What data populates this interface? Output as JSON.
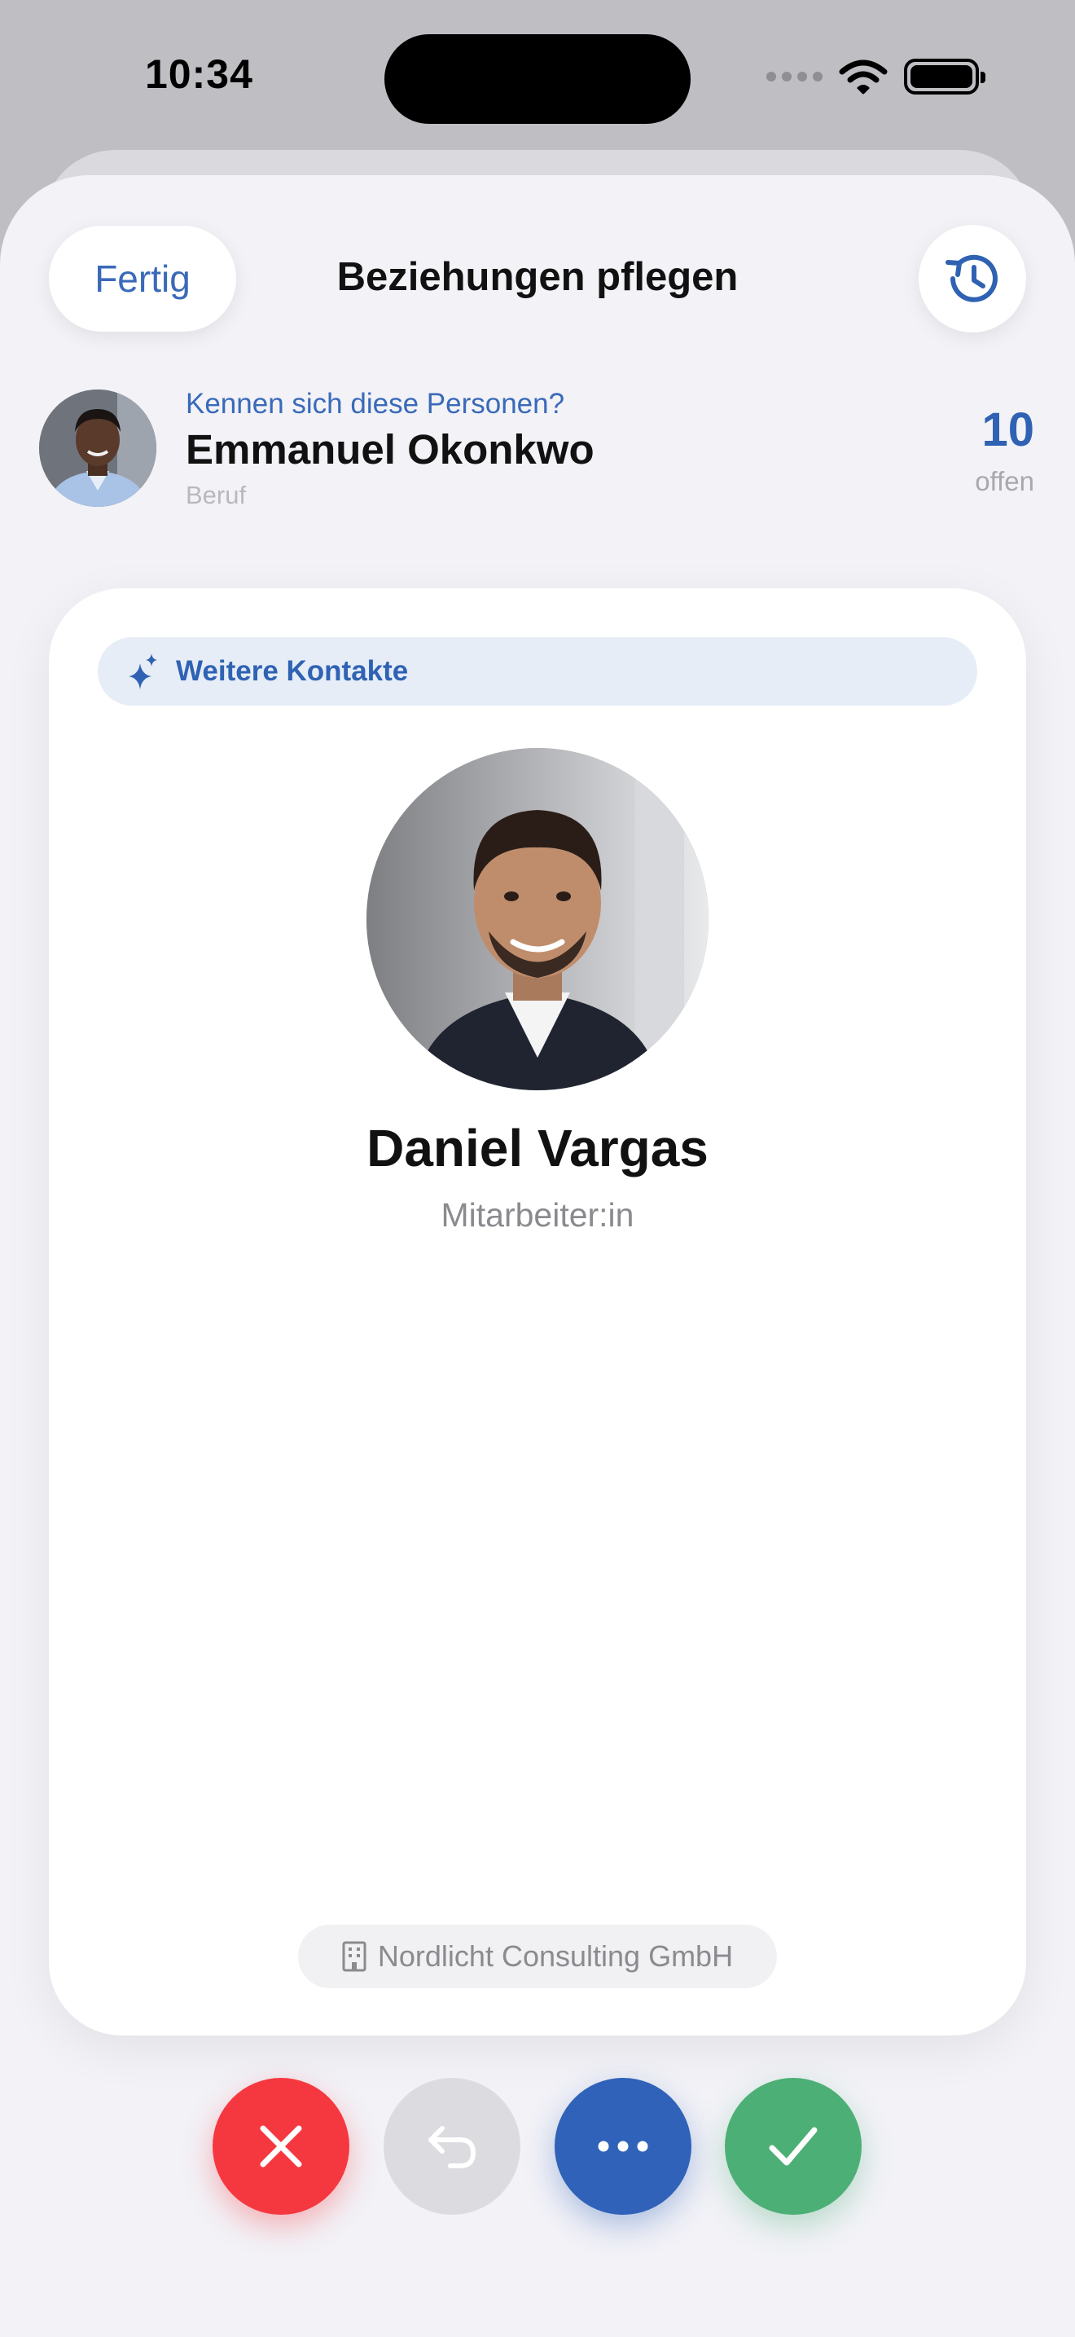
{
  "status_bar": {
    "time": "10:34"
  },
  "nav": {
    "done_label": "Fertig",
    "title": "Beziehungen pflegen",
    "history_icon": "clock-arrow-counterclockwise"
  },
  "source_person": {
    "question": "Kennen sich diese Personen?",
    "name": "Emmanuel Okonkwo",
    "job": "Beruf",
    "open_count": "10",
    "open_label": "offen"
  },
  "card": {
    "tag_icon": "sparkle",
    "tag_label": "Weitere Kontakte",
    "name": "Daniel Vargas",
    "role": "Mitarbeiter:in",
    "company_icon": "building",
    "company": "Nordlicht Consulting GmbH"
  },
  "actions": {
    "reject_icon": "xmark",
    "undo_icon": "arrow-uturn-left",
    "more_icon": "ellipsis",
    "accept_icon": "checkmark"
  },
  "colors": {
    "accent": "#2f62b3",
    "reject": "#f5383f",
    "accept": "#4caf76",
    "undo_disabled": "#dcdce0",
    "background": "#f2f2f7"
  }
}
